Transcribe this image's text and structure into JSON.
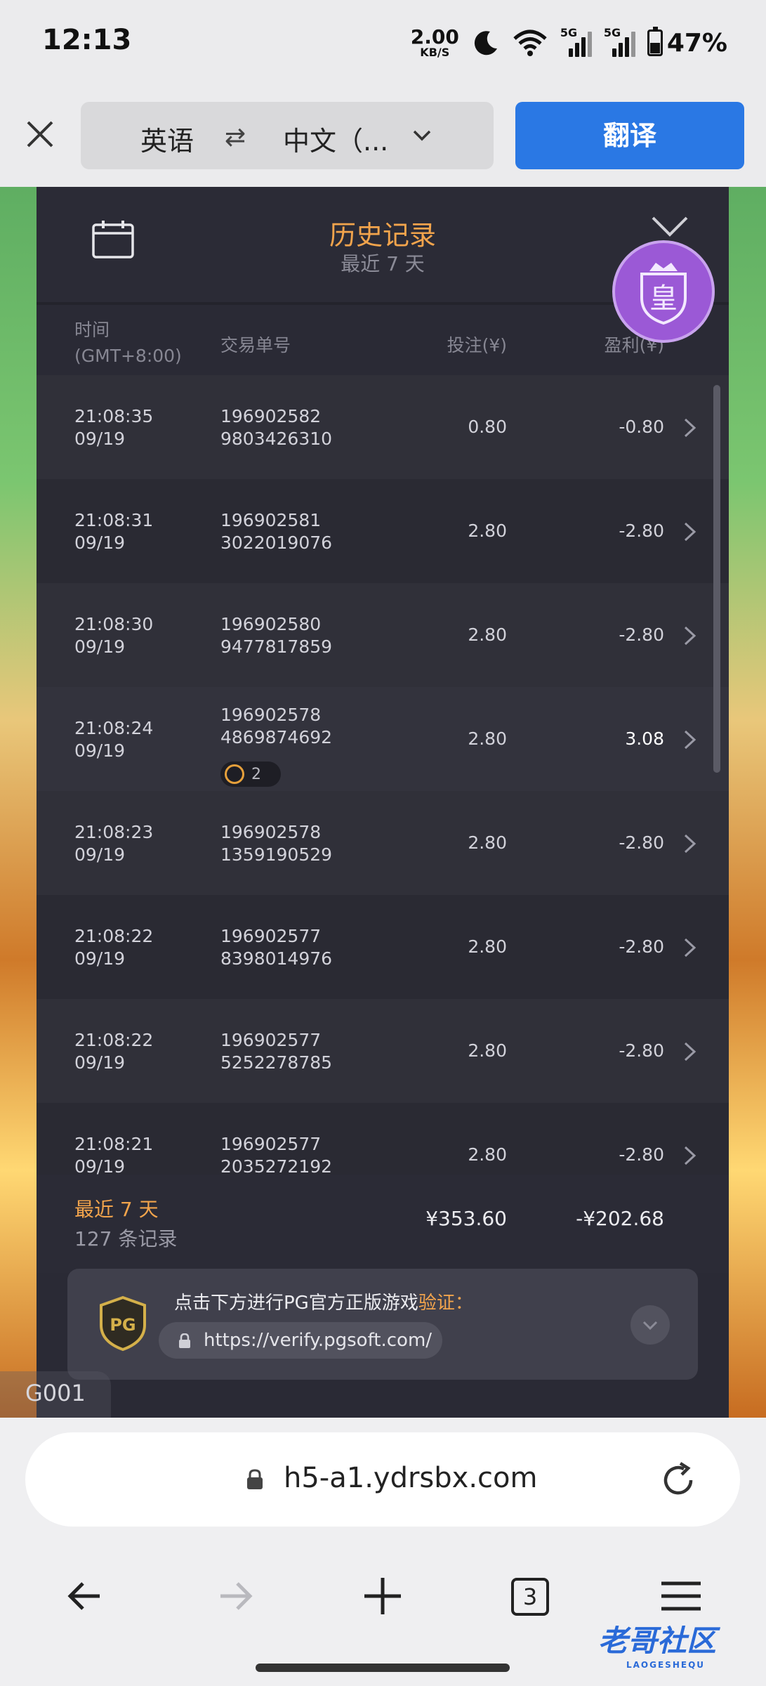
{
  "status_bar": {
    "time": "12:13",
    "speed_value": "2.00",
    "speed_unit": "KB/S",
    "signal1_label": "5G",
    "signal2_label": "5G",
    "battery": "47%",
    "icons": [
      "moon-icon",
      "wifi-icon",
      "signal-icon",
      "battery-icon"
    ]
  },
  "translate_bar": {
    "source_lang": "英语",
    "swap": "⇄",
    "target_lang": "中文（...",
    "translate_label": "翻译"
  },
  "history": {
    "title": "历史记录",
    "subtitle": "最近 7 天",
    "columns": {
      "time": "时间",
      "timezone": "(GMT+8:00)",
      "order_id": "交易单号",
      "bet": "投注(¥)",
      "profit": "盈利(¥)"
    },
    "rows": [
      {
        "time": "21:08:35",
        "date": "09/19",
        "id1": "196902582",
        "id2": "9803426310",
        "bet": "0.80",
        "profit": "-0.80"
      },
      {
        "time": "21:08:31",
        "date": "09/19",
        "id1": "196902581",
        "id2": "3022019076",
        "bet": "2.80",
        "profit": "-2.80"
      },
      {
        "time": "21:08:30",
        "date": "09/19",
        "id1": "196902580",
        "id2": "9477817859",
        "bet": "2.80",
        "profit": "-2.80"
      },
      {
        "time": "21:08:24",
        "date": "09/19",
        "id1": "196902578",
        "id2": "4869874692",
        "bet": "2.80",
        "profit": "3.08",
        "badge": "2"
      },
      {
        "time": "21:08:23",
        "date": "09/19",
        "id1": "196902578",
        "id2": "1359190529",
        "bet": "2.80",
        "profit": "-2.80"
      },
      {
        "time": "21:08:22",
        "date": "09/19",
        "id1": "196902577",
        "id2": "8398014976",
        "bet": "2.80",
        "profit": "-2.80"
      },
      {
        "time": "21:08:22",
        "date": "09/19",
        "id1": "196902577",
        "id2": "5252278785",
        "bet": "2.80",
        "profit": "-2.80"
      },
      {
        "time": "21:08:21",
        "date": "09/19",
        "id1": "196902577",
        "id2": "2035272192",
        "bet": "2.80",
        "profit": "-2.80"
      }
    ],
    "summary": {
      "range": "最近 7 天",
      "count": "127 条记录",
      "total_bet": "¥353.60",
      "total_profit": "-¥202.68"
    },
    "verify": {
      "text": "点击下方进行PG官方正版游戏",
      "highlight": "验证：",
      "link": "https://verify.pgsoft.com/",
      "logo_text": "PG"
    },
    "avatar_char": "皇",
    "game_code": "G001"
  },
  "url_bar": {
    "url": "h5-a1.ydrsbx.com"
  },
  "bottom_nav": {
    "tab_count": "3"
  },
  "watermark": {
    "text": "老哥社区",
    "sub": "LAOGESHEQU"
  },
  "colors": {
    "accent": "#f2a44c",
    "translate_button": "#2a78e4",
    "panel": "#2a2a35"
  }
}
